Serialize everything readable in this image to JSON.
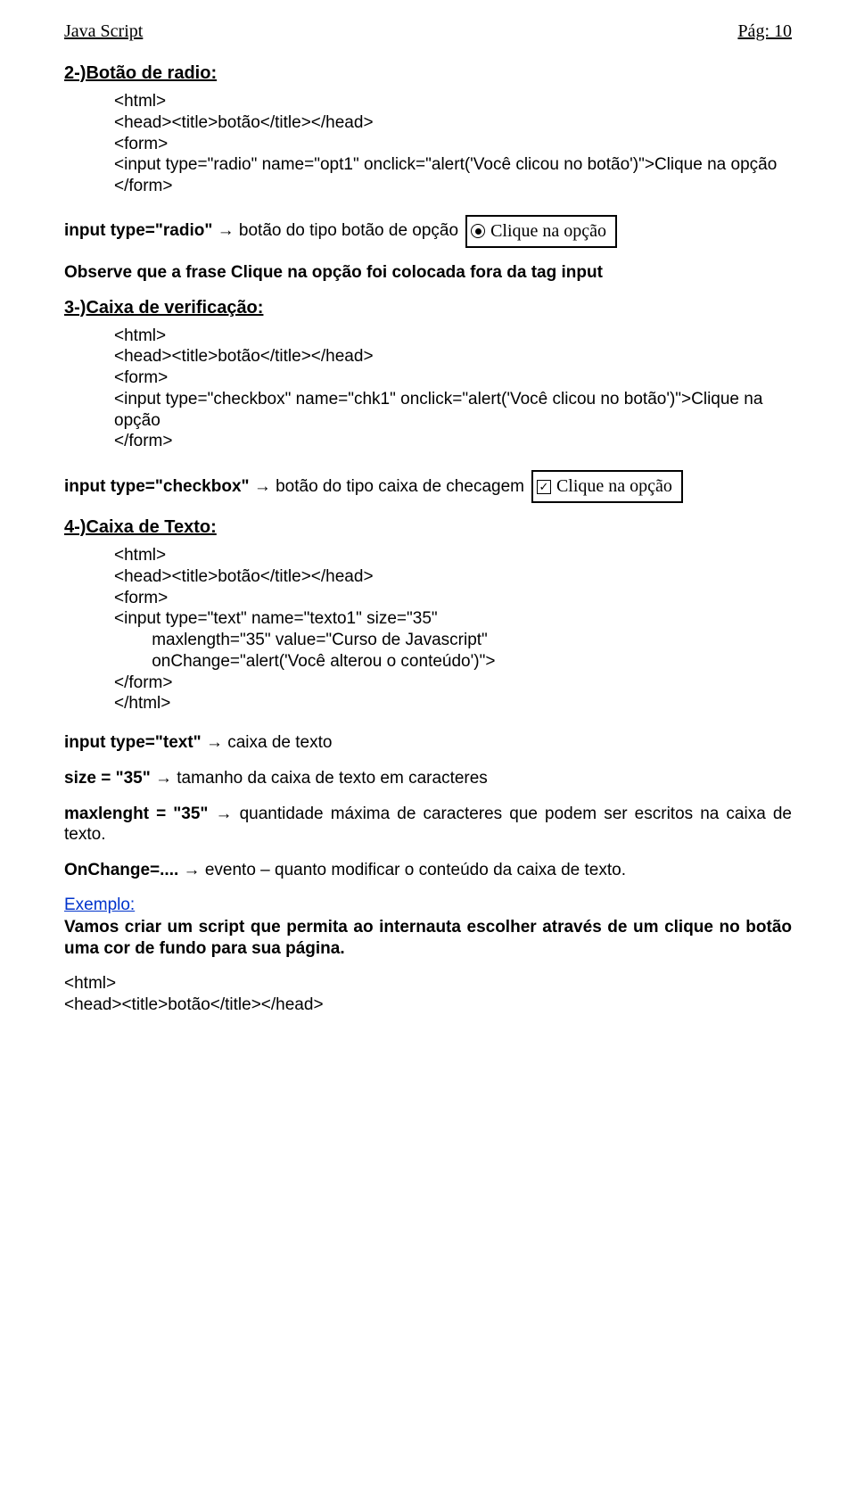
{
  "header": {
    "left": "Java Script",
    "right": "Pág: 10"
  },
  "section2": {
    "title": "2-)Botão de radio:",
    "code": "<html>\n<head><title>botão</title></head>\n<form>\n<input type=\"radio\" name=\"opt1\" onclick=\"alert('Você clicou no botão')\">Clique na opção\n</form>",
    "note_prefix": "input type=\"radio\"",
    "arrow": " → ",
    "note_suffix": "botão do tipo botão de opção ",
    "example_label": "Clique na opção",
    "observe": "Observe que a frase Clique na opção foi colocada fora da tag input"
  },
  "section3": {
    "title": "3-)Caixa de verificação:",
    "code": "<html>\n<head><title>botão</title></head>\n<form>\n<input type=\"checkbox\" name=\"chk1\" onclick=\"alert('Você clicou no botão')\">Clique na opção\n</form>",
    "note_prefix": "input type=\"checkbox\"",
    "arrow": " → ",
    "note_suffix": "botão do tipo caixa de checagem ",
    "example_label": "Clique na opção"
  },
  "section4": {
    "title": "4-)Caixa de Texto:",
    "code": "<html>\n<head><title>botão</title></head>\n<form>\n<input type=\"text\" name=\"texto1\" size=\"35\"\n        maxlength=\"35\" value=\"Curso de Javascript\"\n        onChange=\"alert('Você alterou o conteúdo')\">\n</form>\n</html>",
    "desc1_prefix": "input type=\"text\"",
    "arrow": " → ",
    "desc1_suffix": "caixa de texto",
    "desc2_prefix": "size = \"35\"",
    "desc2_suffix": "tamanho da caixa de texto em caracteres",
    "desc3_prefix": "maxlenght = \"35\"",
    "desc3_suffix": "quantidade máxima de caracteres que podem ser escritos na caixa de texto.",
    "desc4_prefix": "OnChange=....",
    "desc4_suffix": "evento – quanto modificar o conteúdo da caixa de texto.",
    "exemplo_label": "Exemplo:",
    "exemplo_text": "Vamos criar um script que permita ao internauta escolher através de um clique no botão uma cor de fundo para sua página.",
    "code2": "<html>\n<head><title>botão</title></head>"
  }
}
